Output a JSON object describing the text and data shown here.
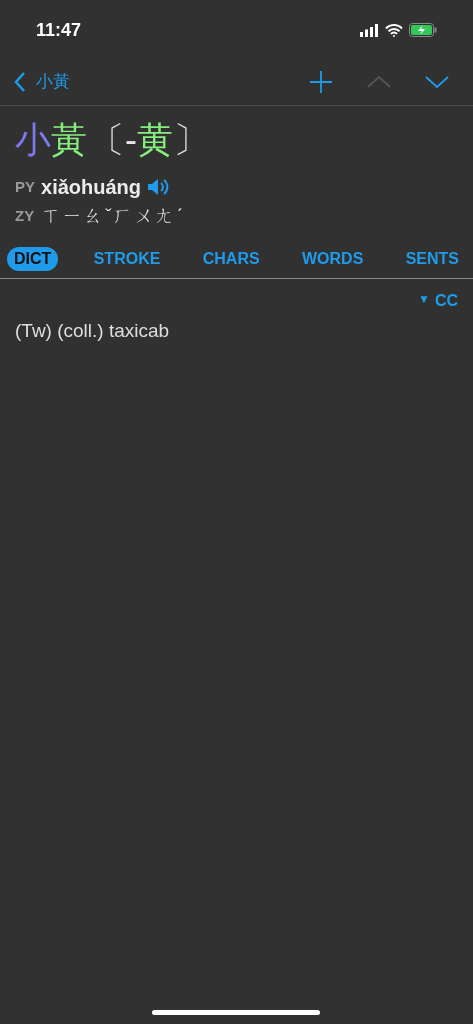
{
  "status_bar": {
    "time": "11:47"
  },
  "nav": {
    "back_label": "小黃",
    "buttons": [
      {
        "kind": "add",
        "disabled": false
      },
      {
        "kind": "up",
        "disabled": true
      },
      {
        "kind": "down",
        "disabled": false
      }
    ]
  },
  "headword": {
    "characters": [
      {
        "text": "小",
        "color": "#7b78f0"
      },
      {
        "text": "黃",
        "color": "#86ee7e"
      }
    ],
    "variant_open": "〔",
    "variant": [
      {
        "text": "-",
        "color": "#e6e6e6"
      },
      {
        "text": "黄",
        "color": "#86ee7e"
      }
    ],
    "variant_close": "〕"
  },
  "pinyin": {
    "label": "PY",
    "text": "xiǎohuáng"
  },
  "zhuyin": {
    "label": "ZY",
    "text": "ㄒㄧㄠˇㄏㄨㄤˊ"
  },
  "tabs": [
    {
      "label": "DICT",
      "selected": true
    },
    {
      "label": "STROKE",
      "selected": false
    },
    {
      "label": "CHARS",
      "selected": false
    },
    {
      "label": "WORDS",
      "selected": false
    },
    {
      "label": "SENTS",
      "selected": false
    }
  ],
  "source": {
    "marker": "▼",
    "label": "CC"
  },
  "definition": "(Tw) (coll.) taxicab"
}
